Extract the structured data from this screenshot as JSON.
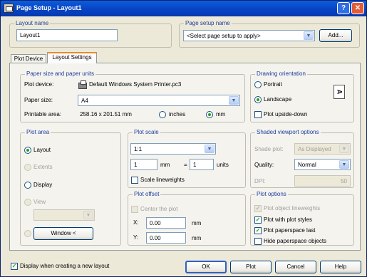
{
  "window": {
    "title": "Page Setup - Layout1"
  },
  "layout_name": {
    "label": "Layout name",
    "value": "Layout1"
  },
  "page_setup_name": {
    "label": "Page setup name",
    "value": "<Select page setup to apply>",
    "add_button": "Add..."
  },
  "tabs": [
    {
      "label": "Plot Device"
    },
    {
      "label": "Layout Settings"
    }
  ],
  "paper": {
    "group_label": "Paper size and paper units",
    "plot_device_label": "Plot device:",
    "plot_device_value": "Default Windows System Printer.pc3",
    "paper_size_label": "Paper size:",
    "paper_size_value": "A4",
    "printable_area_label": "Printable area:",
    "printable_area_value": "258.16 x 201.51 mm",
    "inches_label": "inches",
    "mm_label": "mm",
    "units_selected": "mm"
  },
  "orientation": {
    "group_label": "Drawing orientation",
    "portrait": "Portrait",
    "landscape": "Landscape",
    "upside_down": "Plot upside-down",
    "selected": "landscape",
    "icon_letter": "A"
  },
  "plot_area": {
    "group_label": "Plot area",
    "layout": "Layout",
    "extents": "Extents",
    "display": "Display",
    "view": "View",
    "window_button": "Window <",
    "selected": "layout"
  },
  "plot_scale": {
    "group_label": "Plot scale",
    "scale_value": "1:1",
    "mm_value": "1",
    "mm_label": "mm",
    "equals": "=",
    "units_value": "1",
    "units_label": "units",
    "lineweights_label": "Scale lineweights"
  },
  "plot_offset": {
    "group_label": "Plot offset",
    "center_label": "Center the plot",
    "x_label": "X:",
    "x_value": "0.00",
    "x_unit": "mm",
    "y_label": "Y:",
    "y_value": "0.00",
    "y_unit": "mm"
  },
  "shaded_viewport": {
    "group_label": "Shaded viewport options",
    "shade_plot_label": "Shade plot:",
    "shade_plot_value": "As Displayed",
    "quality_label": "Quality:",
    "quality_value": "Normal",
    "dpi_label": "DPI:",
    "dpi_value": "50"
  },
  "plot_options": {
    "group_label": "Plot options",
    "items": [
      {
        "label": "Plot object lineweights",
        "checked": true,
        "disabled": true
      },
      {
        "label": "Plot with plot styles",
        "checked": true,
        "disabled": false
      },
      {
        "label": "Plot paperspace last",
        "checked": true,
        "disabled": false
      },
      {
        "label": "Hide paperspace objects",
        "checked": false,
        "disabled": false
      }
    ]
  },
  "footer": {
    "display_checkbox_label": "Display when creating a new layout",
    "ok": "OK",
    "plot": "Plot",
    "cancel": "Cancel",
    "help": "Help"
  }
}
